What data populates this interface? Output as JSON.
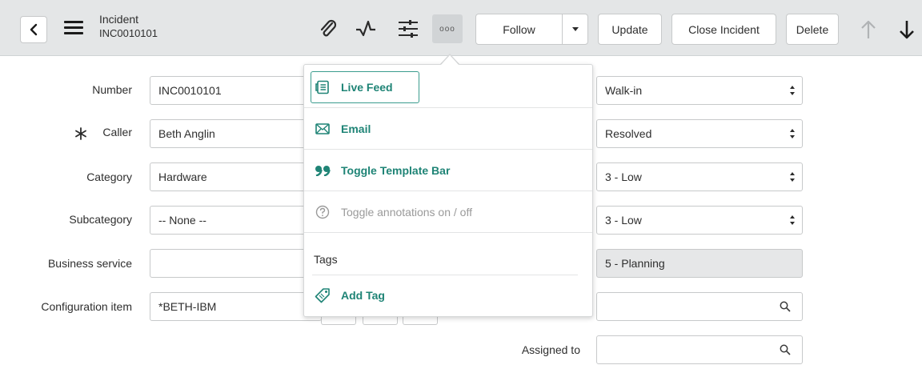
{
  "header": {
    "record_type": "Incident",
    "record_number": "INC0010101",
    "follow_label": "Follow",
    "update_label": "Update",
    "close_label": "Close Incident",
    "delete_label": "Delete",
    "more_label": "ooo"
  },
  "form": {
    "number": {
      "label": "Number",
      "value": "INC0010101"
    },
    "caller": {
      "label": "Caller",
      "value": "Beth Anglin"
    },
    "category": {
      "label": "Category",
      "value": "Hardware"
    },
    "subcategory": {
      "label": "Subcategory",
      "value": "-- None --"
    },
    "business_service": {
      "label": "Business service",
      "value": ""
    },
    "configuration_item": {
      "label": "Configuration item",
      "value": "*BETH-IBM"
    },
    "contact_type": {
      "value": "Walk-in"
    },
    "state": {
      "value": "Resolved"
    },
    "impact": {
      "value": "3 - Low"
    },
    "urgency": {
      "value": "3 - Low"
    },
    "priority": {
      "value": "5 - Planning"
    },
    "assignment_group": {
      "value": ""
    },
    "assigned_to": {
      "label": "Assigned to",
      "value": ""
    }
  },
  "menu": {
    "live_feed": "Live Feed",
    "email": "Email",
    "toggle_template": "Toggle Template Bar",
    "toggle_annotations": "Toggle annotations on / off",
    "tags_heading": "Tags",
    "add_tag": "Add Tag"
  },
  "colors": {
    "accent": "#1f8476",
    "header_bg": "#e4e6e7",
    "disabled": "#9a9a9a"
  },
  "icons": [
    "chevron-left-icon",
    "menu-icon",
    "paperclip-icon",
    "activity-icon",
    "sliders-icon",
    "ellipsis-icon",
    "caret-down-icon",
    "arrow-up-icon",
    "arrow-down-icon",
    "required-asterisk-icon",
    "search-icon",
    "live-feed-icon",
    "envelope-icon",
    "quote-icon",
    "help-circle-icon",
    "tag-icon"
  ]
}
